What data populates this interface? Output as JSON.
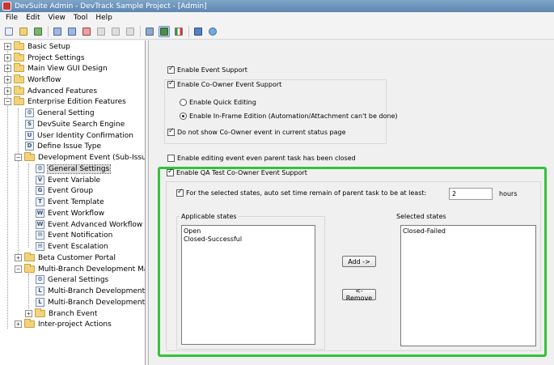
{
  "window": {
    "title": "DevSuite Admin - DevTrack Sample Project - [Admin]"
  },
  "menu": [
    "File",
    "Edit",
    "View",
    "Tool",
    "Help"
  ],
  "toolbar": {
    "icons": [
      "new-doc-icon",
      "open-doc-icon",
      "save-all-icon",
      "import-icon",
      "export-icon",
      "delete-icon",
      "cut-icon",
      "copy-icon",
      "paste-icon",
      "users-icon",
      "view-icon",
      "flag-icon",
      "save-icon",
      "refresh-icon"
    ]
  },
  "tree": {
    "items": [
      {
        "label": "Basic Setup"
      },
      {
        "label": "Project Settings"
      },
      {
        "label": "Main View GUI Design"
      },
      {
        "label": "Workflow"
      },
      {
        "label": "Advanced Features"
      },
      {
        "label": "Enterprise Edition Features"
      },
      {
        "label": "General Setting"
      },
      {
        "label": "DevSuite Search Engine"
      },
      {
        "label": "User Identity Confirmation"
      },
      {
        "label": "Define Issue Type"
      },
      {
        "label": "Development Event (Sub-Issue)"
      },
      {
        "label": "General Settings"
      },
      {
        "label": "Event Variable"
      },
      {
        "label": "Event Group"
      },
      {
        "label": "Event Template"
      },
      {
        "label": "Event Workflow"
      },
      {
        "label": "Event Advanced Workflow"
      },
      {
        "label": "Event Notification"
      },
      {
        "label": "Event Escalation"
      },
      {
        "label": "Beta Customer Portal"
      },
      {
        "label": "Multi-Branch Development Mana"
      },
      {
        "label": "General Settings"
      },
      {
        "label": "Multi-Branch Development Lir"
      },
      {
        "label": "Multi-Branch Development Lir"
      },
      {
        "label": "Branch Event"
      },
      {
        "label": "Inter-project Actions"
      }
    ]
  },
  "settings": {
    "enable_event_support": {
      "label": "Enable Event Support",
      "checked": true
    },
    "enable_coowner_support": {
      "label": "Enable Co-Owner Event Support",
      "checked": true
    },
    "quick_editing": {
      "label": "Enable Quick Editing",
      "selected": false
    },
    "inframe_edition": {
      "label": "Enable In-Frame Edition (Automation/Attachment can't be done)",
      "selected": true
    },
    "hide_coowner_event": {
      "label": "Do not show Co-Owner event in current status page",
      "checked": true
    },
    "edit_closed_parent": {
      "label": "Enable editing event even parent task has been closed",
      "checked": false
    },
    "qa_test_support": {
      "label": "Enable QA Test Co-Owner Event Support",
      "checked": true
    },
    "auto_set_time": {
      "label": "For the selected states, auto set time remain of parent task to be at least:",
      "checked": true
    },
    "hours_value": "2",
    "hours_unit": "hours"
  },
  "states": {
    "applicable_label": "Applicable states",
    "applicable": [
      "Open",
      "Closed-Successful"
    ],
    "selected_label": "Selected states",
    "selected": [
      "Closed-Failed"
    ],
    "add_button": "Add ->",
    "remove_button": "<-Remove"
  },
  "colors": {
    "highlight": "#34c23a",
    "titlebar": "#6f97bf"
  }
}
